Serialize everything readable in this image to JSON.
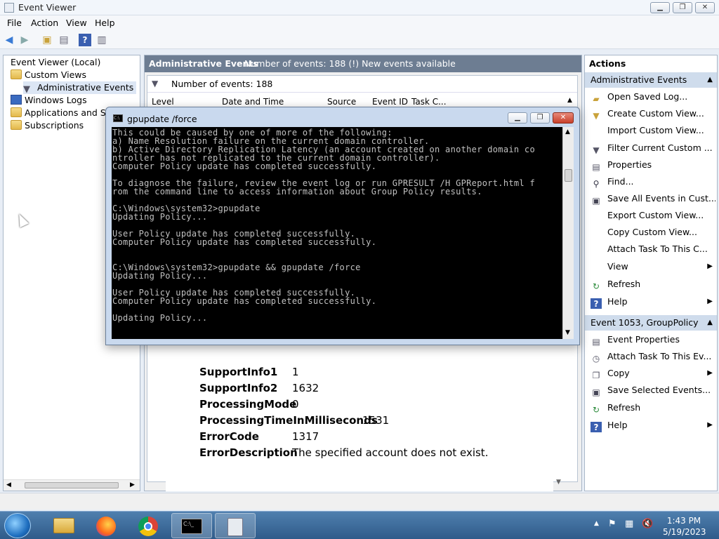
{
  "window": {
    "title": "Event Viewer"
  },
  "menu": [
    "File",
    "Action",
    "View",
    "Help"
  ],
  "tree": {
    "root": "Event Viewer (Local)",
    "items": [
      "Custom Views",
      "Administrative Events",
      "Windows Logs",
      "Applications and Serv",
      "Subscriptions"
    ]
  },
  "center": {
    "title": "Administrative Events",
    "subtitle": "Number of events: 188 (!) New events available",
    "filter_text": "Number of events: 188",
    "columns": [
      "Level",
      "Date and Time",
      "Source",
      "Event ID",
      "Task C..."
    ],
    "details": [
      {
        "key": "SupportInfo1",
        "value": "1"
      },
      {
        "key": "SupportInfo2",
        "value": "1632"
      },
      {
        "key": "ProcessingMode",
        "value": "0"
      },
      {
        "key": "ProcessingTimeInMilliseconds",
        "value": "1531"
      },
      {
        "key": "ErrorCode",
        "value": "1317"
      },
      {
        "key": "ErrorDescription",
        "value": "The specified account does not exist."
      }
    ]
  },
  "actions": {
    "section1": "Administrative Events",
    "items1": [
      "Open Saved Log...",
      "Create Custom View...",
      "Import Custom View...",
      "Filter Current Custom ...",
      "Properties",
      "Find...",
      "Save All Events in Cust...",
      "Export Custom View...",
      "Copy Custom View...",
      "Attach Task To This C...",
      "View",
      "Refresh",
      "Help"
    ],
    "section2": "Event 1053, GroupPolicy",
    "items2": [
      "Event Properties",
      "Attach Task To This Ev...",
      "Copy",
      "Save Selected Events...",
      "Refresh",
      "Help"
    ]
  },
  "console": {
    "title": "gpupdate  /force",
    "text": "This could be caused by one of more of the following:\na) Name Resolution failure on the current domain controller.\nb) Active Directory Replication Latency (an account created on another domain co\nntroller has not replicated to the current domain controller).\nComputer Policy update has completed successfully.\n\nTo diagnose the failure, review the event log or run GPRESULT /H GPReport.html f\nrom the command line to access information about Group Policy results.\n\nC:\\Windows\\system32>gpupdate\nUpdating Policy...\n\nUser Policy update has completed successfully.\nComputer Policy update has completed successfully.\n\n\nC:\\Windows\\system32>gpupdate && gpupdate /force\nUpdating Policy...\n\nUser Policy update has completed successfully.\nComputer Policy update has completed successfully.\n\nUpdating Policy...\n\n_"
  },
  "taskbar": {
    "time": "1:43 PM",
    "date": "5/19/2023"
  },
  "colors": {
    "header": "#6d7d92",
    "actions_header": "#cfdcec",
    "taskbar": "#2f5b8a"
  }
}
